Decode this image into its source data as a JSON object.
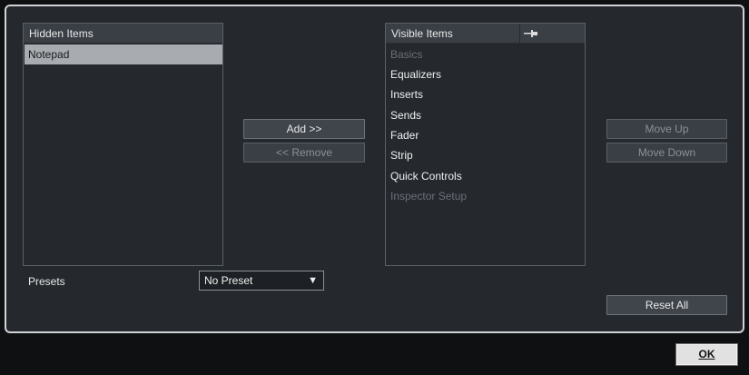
{
  "hidden": {
    "header": "Hidden Items",
    "items": [
      {
        "label": "Notepad",
        "state": "selected"
      }
    ]
  },
  "visible": {
    "header": "Visible Items",
    "items": [
      {
        "label": "Basics",
        "state": "disabled"
      },
      {
        "label": "Equalizers",
        "state": "normal"
      },
      {
        "label": "Inserts",
        "state": "normal"
      },
      {
        "label": "Sends",
        "state": "normal"
      },
      {
        "label": "Fader",
        "state": "normal"
      },
      {
        "label": "Strip",
        "state": "normal"
      },
      {
        "label": "Quick Controls",
        "state": "normal"
      },
      {
        "label": "Inspector Setup",
        "state": "disabled"
      }
    ]
  },
  "buttons": {
    "add": "Add >>",
    "remove": "<< Remove",
    "move_up": "Move Up",
    "move_down": "Move Down",
    "reset_all": "Reset All"
  },
  "presets": {
    "label": "Presets",
    "value": "No Preset"
  },
  "dialog": {
    "ok": "OK"
  },
  "icons": {
    "pin": "pin-icon",
    "dropdown": "triangle-down-icon"
  },
  "colors": {
    "panel": "#25292e",
    "selected_row": "#a8acb1",
    "disabled_text": "#6b7078"
  }
}
